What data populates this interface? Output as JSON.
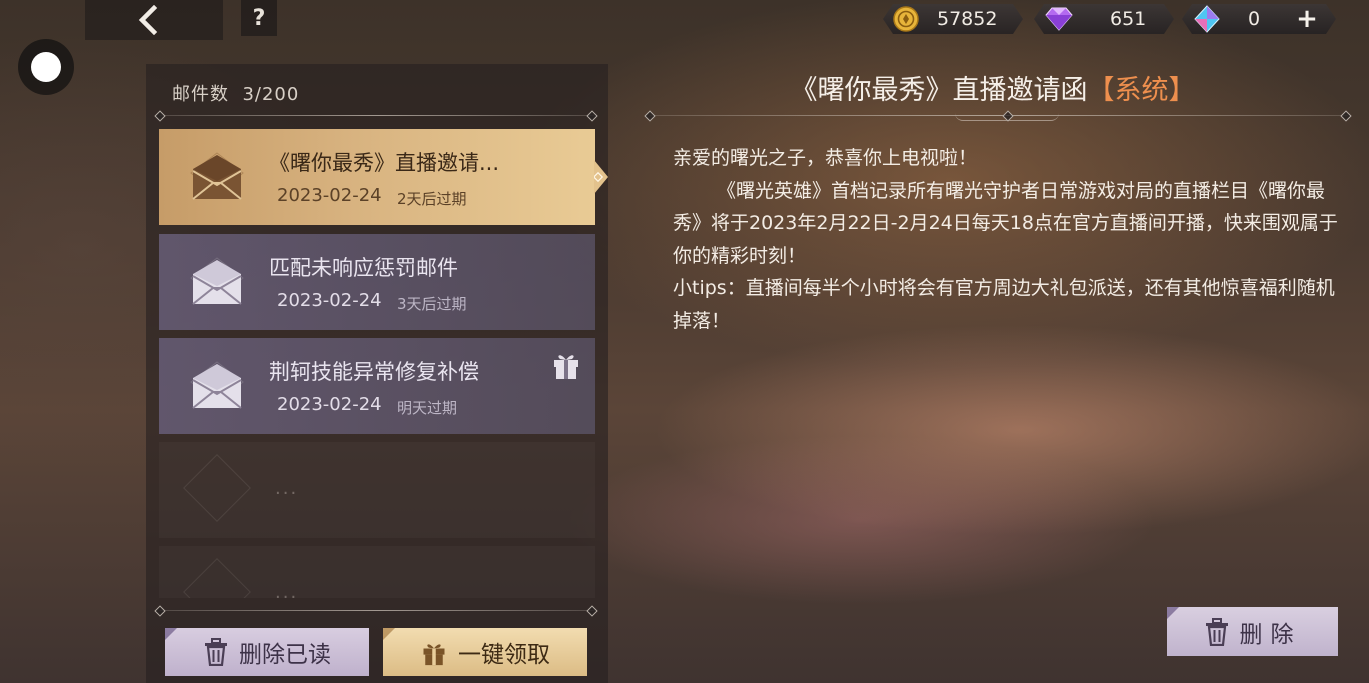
{
  "nav": {
    "back_icon": "chevron-left-icon",
    "help_label": "?",
    "float_icon": "floating-ball-icon"
  },
  "currency": {
    "gold": {
      "icon": "gold-coin-icon",
      "value": "57852"
    },
    "purple_gem": {
      "icon": "purple-diamond-icon",
      "value": "651"
    },
    "blue_gem": {
      "icon": "blue-crystal-icon",
      "value": "0",
      "add_label": "+"
    }
  },
  "mailbox": {
    "count_label": "邮件数  3/200",
    "items": [
      {
        "title": "《曙你最秀》直播邀请...",
        "date": "2023-02-24",
        "expiry": "2天后过期",
        "selected": true,
        "has_gift": false
      },
      {
        "title": "匹配未响应惩罚邮件",
        "date": "2023-02-24",
        "expiry": "3天后过期",
        "selected": false,
        "has_gift": false
      },
      {
        "title": "荆轲技能异常修复补偿",
        "date": "2023-02-24",
        "expiry": "明天过期",
        "selected": false,
        "has_gift": true
      }
    ],
    "placeholder_dots": "...",
    "delete_read_label": "删除已读",
    "claim_all_label": "一键领取"
  },
  "detail": {
    "title": "《曙你最秀》直播邀请函",
    "tag": "【系统】",
    "paragraphs": [
      "亲爱的曙光之子，恭喜你上电视啦！",
      "《曙光英雄》首档记录所有曙光守护者日常游戏对局的直播栏目《曙你最秀》将于2023年2月22日-2月24日每天18点在官方直播间开播，快来围观属于你的精彩时刻！",
      "小tips：直播间每半个小时将会有官方周边大礼包派送，还有其他惊喜福利随机掉落！"
    ],
    "delete_label": "删除"
  },
  "colors": {
    "tag": "#ee8f4e",
    "selected_item": "#d8b380",
    "normal_item": "#6e6482"
  }
}
